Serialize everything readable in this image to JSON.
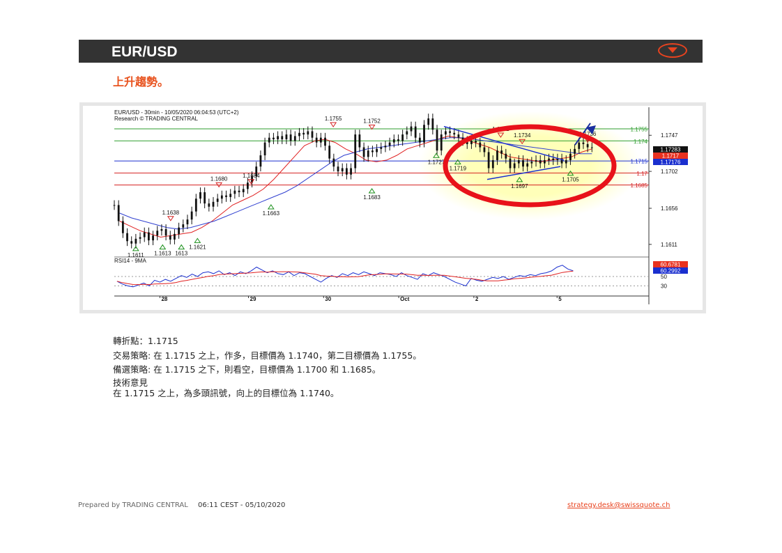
{
  "header": {
    "title": "EUR/USD",
    "menu_icon": "caret-down-icon",
    "accent": "#e8431f"
  },
  "subtitle": "上升趨勢。",
  "chart_data": {
    "type": "line",
    "title": "EUR/USD - 30min - 10/05/2020 06:04:53 (UTC+2)",
    "subtitle": "Research © TRADING CENTRAL",
    "x_tick_labels": [
      "28",
      "29",
      "30",
      "Oct",
      "2",
      "5"
    ],
    "y_tick_labels": [
      "1.1747",
      "1.1702",
      "1.1656",
      "1.1611"
    ],
    "ylim": [
      1.1597,
      1.1775
    ],
    "right_tags": [
      {
        "label": "1.17283",
        "bg": "#111111",
        "fg": "#ffffff"
      },
      {
        "label": "1.1717",
        "bg": "#e8311f",
        "fg": "#ffffff"
      },
      {
        "label": "1.17176",
        "bg": "#1a2fcf",
        "fg": "#ffffff"
      }
    ],
    "levels": [
      {
        "value": 1.1755,
        "color": "#2e9e2e",
        "label": "1.1755"
      },
      {
        "value": 1.174,
        "color": "#2e9e2e",
        "label": "1.174"
      },
      {
        "value": 1.1715,
        "color": "#1a2fcf",
        "label": "1.1715"
      },
      {
        "value": 1.17,
        "color": "#d42020",
        "label": "1.17"
      },
      {
        "value": 1.1685,
        "color": "#d42020",
        "label": "1.1685"
      }
    ],
    "pivot_labels": [
      {
        "t": 0.04,
        "value": 1.1611,
        "label": "1.1611",
        "type": "low"
      },
      {
        "t": 0.09,
        "value": 1.1613,
        "label": "1.1613",
        "type": "low"
      },
      {
        "t": 0.125,
        "value": 1.1613,
        "label": "1613",
        "type": "low"
      },
      {
        "t": 0.155,
        "value": 1.1621,
        "label": "1.1621",
        "type": "low"
      },
      {
        "t": 0.105,
        "value": 1.1638,
        "label": "1.1638",
        "type": "high"
      },
      {
        "t": 0.195,
        "value": 1.168,
        "label": "1.1680",
        "type": "high"
      },
      {
        "t": 0.255,
        "value": 1.1684,
        "label": "1.1684",
        "type": "high"
      },
      {
        "t": 0.292,
        "value": 1.1663,
        "label": "1.1663",
        "type": "low"
      },
      {
        "t": 0.408,
        "value": 1.1755,
        "label": "1.1755",
        "type": "high"
      },
      {
        "t": 0.48,
        "value": 1.1683,
        "label": "1.1683",
        "type": "low"
      },
      {
        "t": 0.48,
        "value": 1.1752,
        "label": "1.1752",
        "type": "high"
      },
      {
        "t": 0.6,
        "value": 1.1727,
        "label": "1.1727",
        "type": "low"
      },
      {
        "t": 0.64,
        "value": 1.1719,
        "label": "1.1719",
        "type": "low"
      },
      {
        "t": 0.72,
        "value": 1.1742,
        "label": "1.1742",
        "type": "high"
      },
      {
        "t": 0.76,
        "value": 1.1734,
        "label": "1.1734",
        "type": "high"
      },
      {
        "t": 0.755,
        "value": 1.1697,
        "label": "1.1697",
        "type": "low"
      },
      {
        "t": 0.85,
        "value": 1.1705,
        "label": "1.1705",
        "type": "low"
      },
      {
        "t": 0.882,
        "value": 1.1736,
        "label": "1.1736",
        "type": "high"
      }
    ],
    "series": [
      {
        "name": "price",
        "color": "#111111",
        "values": [
          1.166,
          1.164,
          1.1625,
          1.1615,
          1.1612,
          1.1618,
          1.162,
          1.1626,
          1.1616,
          1.1622,
          1.1628,
          1.163,
          1.1622,
          1.1617,
          1.1624,
          1.1632,
          1.1636,
          1.1642,
          1.1652,
          1.1668,
          1.1676,
          1.1662,
          1.1658,
          1.1664,
          1.1668,
          1.1672,
          1.167,
          1.1674,
          1.1678,
          1.1676,
          1.168,
          1.1688,
          1.1696,
          1.1708,
          1.1722,
          1.1738,
          1.1744,
          1.1742,
          1.1746,
          1.1742,
          1.1748,
          1.174,
          1.1746,
          1.175,
          1.1748,
          1.1752,
          1.1744,
          1.1738,
          1.1744,
          1.1734,
          1.1718,
          1.1708,
          1.1702,
          1.1706,
          1.1698,
          1.1706,
          1.1748,
          1.1732,
          1.172,
          1.1728,
          1.1726,
          1.173,
          1.1732,
          1.1734,
          1.1738,
          1.1742,
          1.174,
          1.1748,
          1.1752,
          1.1758,
          1.1744,
          1.1738,
          1.176,
          1.1768,
          1.1754,
          1.1728,
          1.1748,
          1.1752,
          1.175,
          1.1748,
          1.1744,
          1.174,
          1.1736,
          1.174,
          1.1738,
          1.1732,
          1.1726,
          1.1706,
          1.1716,
          1.1728,
          1.1724,
          1.1718,
          1.1706,
          1.1712,
          1.1716,
          1.1708,
          1.1712,
          1.1714,
          1.1716,
          1.1712,
          1.1716,
          1.1718,
          1.1716,
          1.1718,
          1.1712,
          1.1716,
          1.1724,
          1.173,
          1.1738,
          1.1736,
          1.1732,
          1.1732
        ]
      },
      {
        "name": "ma_fast",
        "color": "#e02020",
        "values": [
          1.164,
          1.1634,
          1.1628,
          1.1624,
          1.162,
          1.1622,
          1.1624,
          1.1626,
          1.1632,
          1.164,
          1.165,
          1.166,
          1.1666,
          1.1672,
          1.168,
          1.1692,
          1.1706,
          1.172,
          1.1734,
          1.174,
          1.1742,
          1.1738,
          1.173,
          1.1724,
          1.1716,
          1.1714,
          1.1716,
          1.1722,
          1.173,
          1.1734,
          1.1738,
          1.1742,
          1.1746,
          1.1744,
          1.174,
          1.1736,
          1.1732,
          1.1726,
          1.172,
          1.1718,
          1.1716,
          1.1714,
          1.1716,
          1.1718,
          1.172,
          1.1726,
          1.173
        ]
      },
      {
        "name": "ma_slow",
        "color": "#3040d0",
        "values": [
          1.165,
          1.1644,
          1.164,
          1.1636,
          1.1632,
          1.163,
          1.1632,
          1.1636,
          1.164,
          1.1646,
          1.1652,
          1.1658,
          1.1664,
          1.167,
          1.1676,
          1.1684,
          1.1694,
          1.1704,
          1.1714,
          1.1722,
          1.1726,
          1.173,
          1.1732,
          1.1734,
          1.1736,
          1.1738,
          1.174,
          1.1742,
          1.1744,
          1.1744,
          1.1742,
          1.174,
          1.1738,
          1.1736,
          1.1734,
          1.1732,
          1.173,
          1.1728,
          1.1726,
          1.1724,
          1.1724
        ]
      }
    ],
    "rsi": {
      "title": "RSI14 - 9MA",
      "tick_labels": [
        "50",
        "30"
      ],
      "last_values": [
        {
          "label": "60.2992",
          "bg": "#1a2fcf"
        },
        {
          "label": "60.6781",
          "bg": "#e8311f"
        }
      ],
      "values": [
        40,
        34,
        30,
        28,
        32,
        36,
        30,
        42,
        38,
        44,
        40,
        46,
        52,
        48,
        55,
        50,
        58,
        60,
        56,
        62,
        54,
        58,
        52,
        60,
        56,
        62,
        70,
        64,
        58,
        62,
        56,
        54,
        60,
        52,
        58,
        56,
        50,
        44,
        38,
        46,
        52,
        48,
        56,
        52,
        58,
        54,
        60,
        56,
        52,
        58,
        56,
        54,
        50,
        58,
        52,
        48,
        44,
        56,
        52,
        58,
        54,
        50,
        44,
        38,
        34,
        30,
        46,
        42,
        40,
        44,
        48,
        46,
        50,
        44,
        48,
        52,
        50,
        54,
        52,
        56,
        58,
        62,
        70,
        74,
        66,
        62
      ]
    },
    "forecast_arrow_icon": "arrow-up-right-icon",
    "highlight_circle_icon": "red-ellipse-icon"
  },
  "analysis": {
    "pivot": "轉折點：1.1715",
    "strategy": "交易策略: 在 1.1715 之上，作多，目標價為  1.1740，第二目標價為  1.1755。",
    "alternative": "備選策略: 在 1.1715 之下，則看空，目標價為  1.1700 和 1.1685。",
    "comment_title": "技術意見",
    "comment": "在    1.1715 之上，為多頭訊號，向上的目標位為  1.1740。"
  },
  "footer": {
    "prepared_by": "Prepared by TRADING CENTRAL",
    "timestamp": "06:11 CEST - 05/10/2020",
    "email": "strategy.desk@swissquote.ch"
  }
}
